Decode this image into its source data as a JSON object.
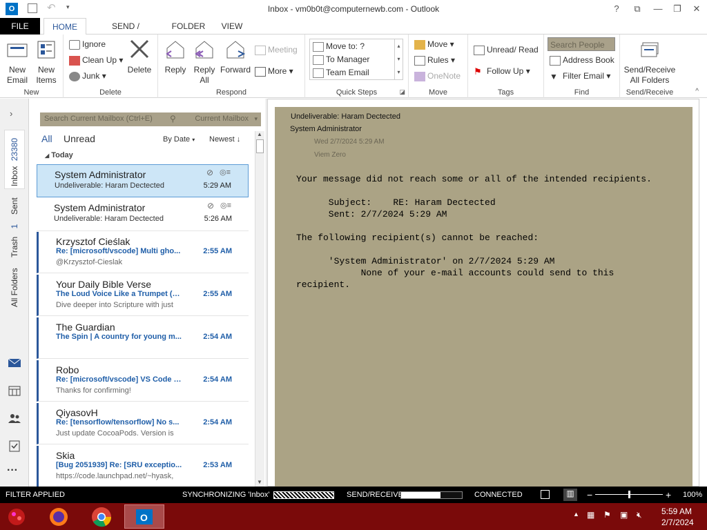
{
  "window": {
    "title": "Inbox - vm0b0t@computernewb.com - Outlook",
    "help": "?",
    "restore": "⧉",
    "minimize": "—",
    "maximize": "❐",
    "close": "✕"
  },
  "tabs": [
    "FILE",
    "HOME",
    "SEND / RECEIVE",
    "FOLDER",
    "VIEW"
  ],
  "ribbon": {
    "new": {
      "label": "New",
      "new_email": "New\nEmail",
      "new_items": "New\nItems"
    },
    "delete": {
      "label": "Delete",
      "ignore": "Ignore",
      "clean_up": "Clean Up",
      "junk": "Junk",
      "delete": "Delete"
    },
    "respond": {
      "label": "Respond",
      "reply": "Reply",
      "reply_all": "Reply\nAll",
      "forward": "Forward",
      "meeting": "Meeting",
      "more": "More"
    },
    "quick_steps": {
      "label": "Quick Steps",
      "items": [
        "Move to: ?",
        "To Manager",
        "Team Email"
      ]
    },
    "move": {
      "label": "Move",
      "move": "Move",
      "rules": "Rules",
      "onenote": "OneNote"
    },
    "tags": {
      "label": "Tags",
      "unread_read": "Unread/ Read",
      "follow_up": "Follow Up"
    },
    "find": {
      "label": "Find",
      "search_people": "Search People",
      "address_book": "Address Book",
      "filter_email": "Filter Email"
    },
    "send_receive": {
      "label": "Send/Receive",
      "send_receive_all": "Send/Receive\nAll Folders"
    }
  },
  "nav": {
    "inbox": "Inbox",
    "inbox_count": "23380",
    "sent": "Sent",
    "trash": "Trash",
    "trash_count": "1",
    "all_folders": "All Folders"
  },
  "list": {
    "search_placeholder": "Search Current Mailbox (Ctrl+E)",
    "search_scope": "Current Mailbox",
    "filter_all": "All",
    "filter_unread": "Unread",
    "sort_by": "By Date",
    "sort_order": "Newest",
    "group_header": "Today",
    "messages": [
      {
        "from": "System Administrator",
        "subject": "Undeliverable: Haram Dectected",
        "preview": "",
        "time": "5:29 AM"
      },
      {
        "from": "System Administrator",
        "subject": "Undeliverable: Haram Dectected",
        "preview": "",
        "time": "5:26 AM"
      },
      {
        "from": "Krzysztof Cieślak",
        "subject": "Re: [microsoft/vscode] Multi gho...",
        "preview": "@Krzysztof-Cieslak",
        "time": "2:55 AM"
      },
      {
        "from": "Your Daily Bible Verse",
        "subject": "The Loud Voice Like a Trumpet (R...",
        "preview": "Dive deeper into Scripture with just",
        "time": "2:55 AM"
      },
      {
        "from": "The Guardian",
        "subject": "The Spin | A country for young m...",
        "preview": "",
        "time": "2:54 AM"
      },
      {
        "from": "Robo",
        "subject": "Re: [microsoft/vscode] VS Code c...",
        "preview": "Thanks for confirming!",
        "time": "2:54 AM"
      },
      {
        "from": "QiyasovH",
        "subject": "Re: [tensorflow/tensorflow] No s...",
        "preview": "Just update CocoaPods. Version is",
        "time": "2:54 AM"
      },
      {
        "from": "Skia",
        "subject": "[Bug 2051939] Re: [SRU exceptio...",
        "preview": "https://code.launchpad.net/~hyask,",
        "time": "2:53 AM"
      }
    ]
  },
  "reading": {
    "subject": "Undeliverable: Haram Dectected",
    "sender": "System Administrator",
    "date": "Wed 2/7/2024 5:29 AM",
    "to": "Viem Zero",
    "body_line1": "Your message did not reach some or all of the intended recipients.",
    "body_subject": "      Subject:    RE: Haram Dectected",
    "body_sent": "      Sent: 2/7/2024 5:29 AM",
    "body_line2": "The following recipient(s) cannot be reached:",
    "body_recipient": "      'System Administrator' on 2/7/2024 5:29 AM",
    "body_reason1": "            None of your e-mail accounts could send to this",
    "body_reason2": "recipient."
  },
  "status": {
    "filter": "FILTER APPLIED",
    "sync": "SYNCHRONIZING  'Inbox'",
    "send_receive": "SEND/RECEIVE",
    "connected": "CONNECTED",
    "zoom": "100%",
    "send_receive_progress": 0.65,
    "zoom_slider_position": 0.5
  },
  "taskbar": {
    "time": "5:59 AM",
    "date": "2/7/2024"
  },
  "colors": {
    "accent": "#2b579a",
    "taskbar": "#7a0a0a",
    "reading_bg": "#aba385",
    "selected": "#cde6f7"
  }
}
